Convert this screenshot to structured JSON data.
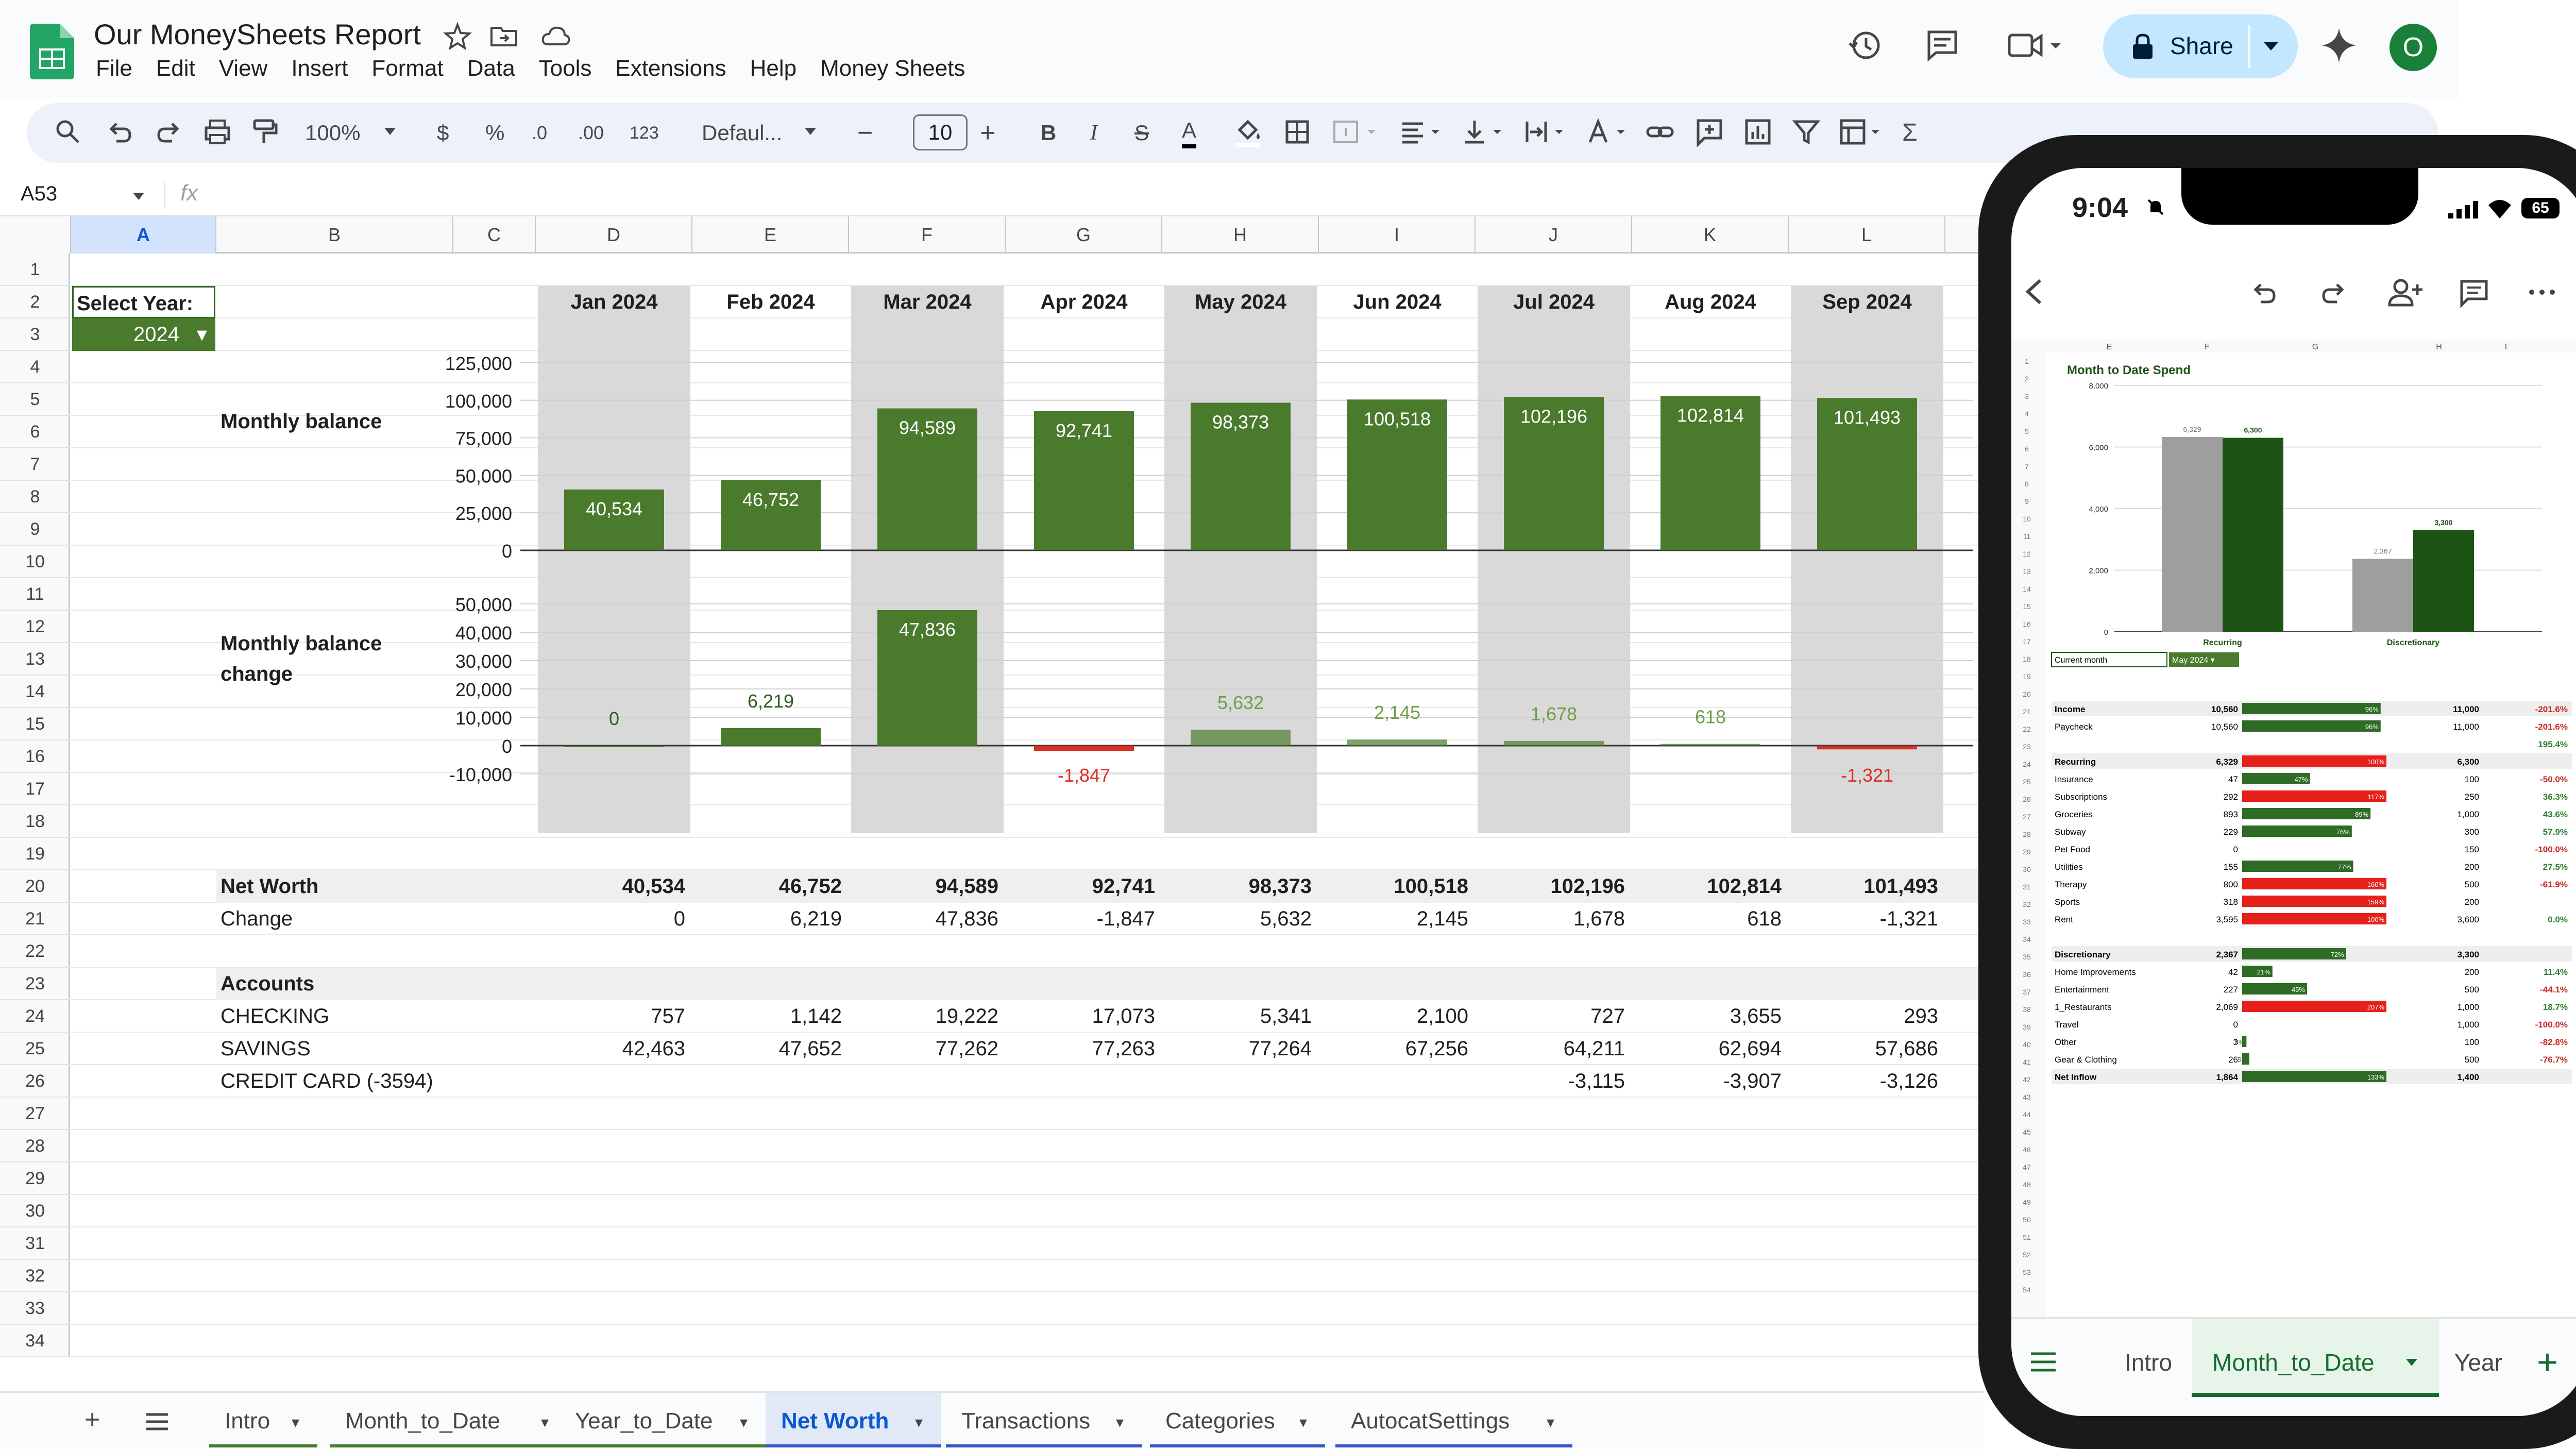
{
  "app": {
    "doc_title": "Our MoneySheets Report",
    "menu": [
      "File",
      "Edit",
      "View",
      "Insert",
      "Format",
      "Data",
      "Tools",
      "Extensions",
      "Help",
      "Money Sheets"
    ],
    "share_label": "Share",
    "avatar_letter": "O",
    "accent": "#c2e7ff"
  },
  "toolbar": {
    "zoom": "100%",
    "currency": "$",
    "percent": "%",
    "dec_less": ".0",
    "dec_more": ".00",
    "format_123": "123",
    "font": "Defaul...",
    "font_size": "10"
  },
  "formula": {
    "name_box": "A53",
    "fx": "fx"
  },
  "columns": [
    "A",
    "B",
    "C",
    "D",
    "E",
    "F",
    "G",
    "H",
    "I",
    "J",
    "K",
    "L"
  ],
  "rows": [
    "1",
    "2",
    "3",
    "4",
    "5",
    "6",
    "7",
    "8",
    "9",
    "10",
    "11",
    "12",
    "13",
    "14",
    "15",
    "16",
    "17",
    "18",
    "19",
    "20",
    "21",
    "22",
    "23",
    "24",
    "25",
    "26",
    "27",
    "28",
    "29",
    "30",
    "31",
    "32",
    "33",
    "34"
  ],
  "sheet": {
    "select_year_label": "Select Year:",
    "year": "2024",
    "months": [
      "Jan 2024",
      "Feb 2024",
      "Mar 2024",
      "Apr 2024",
      "May 2024",
      "Jun 2024",
      "Jul 2024",
      "Aug 2024",
      "Sep 2024"
    ],
    "monthly_balance_label": "Monthly balance",
    "monthly_change_label_1": "Monthly balance",
    "monthly_change_label_2": "change",
    "net_worth_label": "Net Worth",
    "change_label": "Change",
    "accounts_label": "Accounts",
    "net_worth_values": [
      "40,534",
      "46,752",
      "94,589",
      "92,741",
      "98,373",
      "100,518",
      "102,196",
      "102,814",
      "101,493"
    ],
    "change_values": [
      "0",
      "6,219",
      "47,836",
      "-1,847",
      "5,632",
      "2,145",
      "1,678",
      "618",
      "-1,321"
    ],
    "accounts": [
      {
        "name": "CHECKING",
        "values": [
          "757",
          "1,142",
          "19,222",
          "17,073",
          "5,341",
          "2,100",
          "727",
          "3,655",
          "293"
        ]
      },
      {
        "name": "SAVINGS",
        "values": [
          "42,463",
          "47,652",
          "77,262",
          "77,263",
          "77,264",
          "67,256",
          "64,211",
          "62,694",
          "57,686"
        ]
      },
      {
        "name": "CREDIT CARD (-3594)",
        "values": [
          "",
          "",
          "",
          "",
          "",
          "",
          "-3,115",
          "-3,907",
          "-3,126"
        ]
      }
    ]
  },
  "chart_data": [
    {
      "type": "bar",
      "categories": [
        "Jan 2024",
        "Feb 2024",
        "Mar 2024",
        "Apr 2024",
        "May 2024",
        "Jun 2024",
        "Jul 2024",
        "Aug 2024",
        "Sep 2024"
      ],
      "values": [
        40534,
        46752,
        94589,
        92741,
        98373,
        100518,
        102196,
        102814,
        101493
      ],
      "labels": [
        "40,534",
        "46,752",
        "94,589",
        "92,741",
        "98,373",
        "100,518",
        "102,196",
        "102,814",
        "101,493"
      ],
      "yticks": [
        "0",
        "25,000",
        "50,000",
        "75,000",
        "100,000",
        "125,000"
      ],
      "ylim": [
        0,
        125000
      ],
      "color": "#4a7a2c"
    },
    {
      "type": "bar",
      "categories": [
        "Jan 2024",
        "Feb 2024",
        "Mar 2024",
        "Apr 2024",
        "May 2024",
        "Jun 2024",
        "Jul 2024",
        "Aug 2024",
        "Sep 2024"
      ],
      "values": [
        0,
        6219,
        47836,
        -1847,
        5632,
        2145,
        1678,
        618,
        -1321
      ],
      "labels": [
        "0",
        "6,219",
        "47,836",
        "-1,847",
        "5,632",
        "2,145",
        "1,678",
        "618",
        "-1,321"
      ],
      "yticks": [
        "-10,000",
        "0",
        "10,000",
        "20,000",
        "30,000",
        "40,000",
        "50,000"
      ],
      "ylim": [
        -10000,
        50000
      ],
      "pos_color": "#4a7a2c",
      "neg_color": "#d93025"
    },
    {
      "type": "bar",
      "title": "Month to Date Spend",
      "categories": [
        "Recurring",
        "Discretionary"
      ],
      "series": [
        {
          "values": [
            6329,
            2367
          ],
          "labels": [
            "6,329",
            "2,367"
          ],
          "color": "#9e9e9e"
        },
        {
          "values": [
            6300,
            3300
          ],
          "labels": [
            "6,300",
            "3,300"
          ],
          "color": "#1e5316"
        }
      ],
      "yticks": [
        "0",
        "2,000",
        "4,000",
        "6,000",
        "8,000"
      ],
      "ylim": [
        0,
        8000
      ]
    }
  ],
  "tabs": [
    "Intro",
    "Month_to_Date",
    "Year_to_Date",
    "Net Worth",
    "Transactions",
    "Categories",
    "AutocatSettings"
  ],
  "phone": {
    "time": "9:04",
    "battery": "65",
    "cols": [
      "E",
      "F",
      "G",
      "H",
      "I"
    ],
    "current_month_label": "Current month",
    "current_month_value": "May 2024",
    "table": [
      {
        "label": "Income",
        "a": "10,560",
        "pct": "96%",
        "b": "11,000",
        "c": "-201.6%",
        "bold": true,
        "ratio": 0.96,
        "kind": "g"
      },
      {
        "label": "Paycheck",
        "a": "10,560",
        "pct": "96%",
        "b": "11,000",
        "c": "-201.6%",
        "bold": false,
        "ratio": 0.96,
        "kind": "g"
      },
      {
        "label": "",
        "a": "",
        "pct": "",
        "b": "",
        "c": "195.4%",
        "bold": false,
        "ratio": 0,
        "kind": "g"
      },
      {
        "label": "Recurring",
        "a": "6,329",
        "pct": "100%",
        "b": "6,300",
        "c": "",
        "bold": true,
        "ratio": 1.0,
        "kind": "r"
      },
      {
        "label": "Insurance",
        "a": "47",
        "pct": "47%",
        "b": "100",
        "c": "-50.0%",
        "bold": false,
        "ratio": 0.47,
        "kind": "g"
      },
      {
        "label": "Subscriptions",
        "a": "292",
        "pct": "117%",
        "b": "250",
        "c": "36.3%",
        "bold": false,
        "ratio": 1.0,
        "kind": "r"
      },
      {
        "label": "Groceries",
        "a": "893",
        "pct": "89%",
        "b": "1,000",
        "c": "43.6%",
        "bold": false,
        "ratio": 0.89,
        "kind": "g"
      },
      {
        "label": "Subway",
        "a": "229",
        "pct": "76%",
        "b": "300",
        "c": "57.9%",
        "bold": false,
        "ratio": 0.76,
        "kind": "g"
      },
      {
        "label": "Pet Food",
        "a": "0",
        "pct": "",
        "b": "150",
        "c": "-100.0%",
        "bold": false,
        "ratio": 0,
        "kind": "g"
      },
      {
        "label": "Utilities",
        "a": "155",
        "pct": "77%",
        "b": "200",
        "c": "27.5%",
        "bold": false,
        "ratio": 0.77,
        "kind": "g"
      },
      {
        "label": "Therapy",
        "a": "800",
        "pct": "160%",
        "b": "500",
        "c": "-61.9%",
        "bold": false,
        "ratio": 1.0,
        "kind": "r"
      },
      {
        "label": "Sports",
        "a": "318",
        "pct": "159%",
        "b": "200",
        "c": "",
        "bold": false,
        "ratio": 1.0,
        "kind": "r"
      },
      {
        "label": "Rent",
        "a": "3,595",
        "pct": "100%",
        "b": "3,600",
        "c": "0.0%",
        "bold": false,
        "ratio": 1.0,
        "kind": "r"
      },
      {
        "label": "",
        "a": "",
        "pct": "",
        "b": "",
        "c": "",
        "bold": false,
        "ratio": 0,
        "kind": "g"
      },
      {
        "label": "Discretionary",
        "a": "2,367",
        "pct": "72%",
        "b": "3,300",
        "c": "",
        "bold": true,
        "ratio": 0.72,
        "kind": "g"
      },
      {
        "label": "Home Improvements",
        "a": "42",
        "pct": "21%",
        "b": "200",
        "c": "11.4%",
        "bold": false,
        "ratio": 0.21,
        "kind": "g"
      },
      {
        "label": "Entertainment",
        "a": "227",
        "pct": "45%",
        "b": "500",
        "c": "-44.1%",
        "bold": false,
        "ratio": 0.45,
        "kind": "g"
      },
      {
        "label": "1_Restaurants",
        "a": "2,069",
        "pct": "207%",
        "b": "1,000",
        "c": "18.7%",
        "bold": false,
        "ratio": 1.0,
        "kind": "r"
      },
      {
        "label": "Travel",
        "a": "0",
        "pct": "",
        "b": "1,000",
        "c": "-100.0%",
        "bold": false,
        "ratio": 0,
        "kind": "g"
      },
      {
        "label": "Other",
        "a": "3",
        "pct": "3%",
        "b": "100",
        "c": "-82.8%",
        "bold": false,
        "ratio": 0.03,
        "kind": "g"
      },
      {
        "label": "Gear & Clothing",
        "a": "26",
        "pct": "5%",
        "b": "500",
        "c": "-76.7%",
        "bold": false,
        "ratio": 0.05,
        "kind": "g"
      },
      {
        "label": "Net Inflow",
        "a": "1,864",
        "pct": "133%",
        "b": "1,400",
        "c": "",
        "bold": true,
        "ratio": 1.0,
        "kind": "g"
      }
    ],
    "tabs": [
      "Intro",
      "Month_to_Date",
      "Year"
    ]
  }
}
